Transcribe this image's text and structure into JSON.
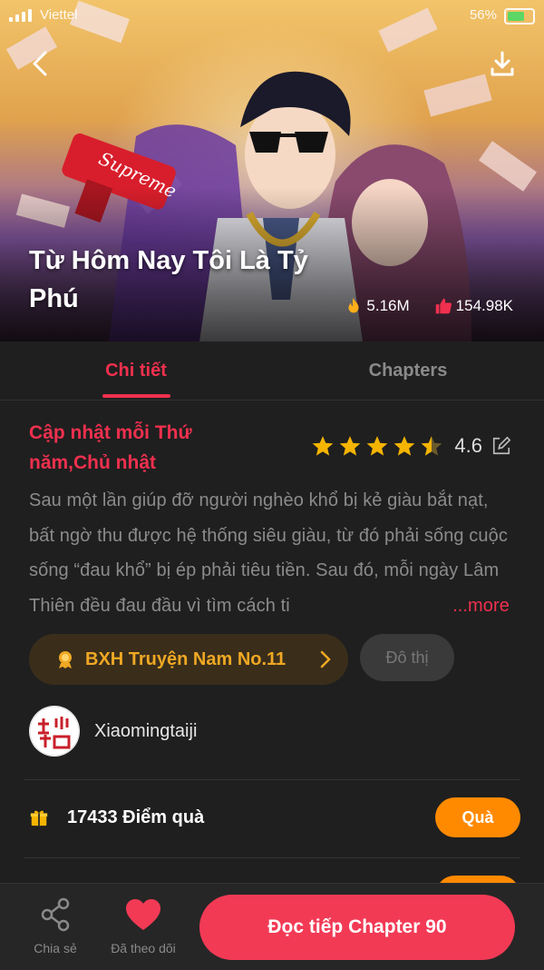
{
  "status_bar": {
    "carrier": "Viettel",
    "battery": "56%"
  },
  "hero": {
    "title": "Từ Hôm Nay Tôi Là Tỷ Phú",
    "views": "5.16M",
    "likes": "154.98K"
  },
  "tabs": [
    {
      "label": "Chi tiết",
      "active": true
    },
    {
      "label": "Chapters",
      "active": false
    }
  ],
  "details": {
    "schedule": "Cập nhật mỗi Thứ năm,Chủ nhật",
    "rating": "4.6",
    "rating_stars": 4.5,
    "description": "Sau một lần giúp đỡ người nghèo khổ bị kẻ giàu bắt nạt, bất ngờ thu được hệ thống siêu giàu, từ đó phải sống cuộc sống “đau khổ” bị ép phải tiêu tiền. Sau đó, mỗi ngày Lâm Thiên đều đau đầu vì tìm cách ti",
    "more": "...more",
    "rank": "BXH Truyện Nam No.11",
    "genre": "Đô thị"
  },
  "author": {
    "name": "Xiaomingtaiji"
  },
  "gift": {
    "points": "17433 Điểm quà",
    "button": "Quà"
  },
  "bottom_bar": {
    "share": "Chia sẻ",
    "follow": "Đã theo dõi",
    "read": "Đọc tiếp Chapter 90"
  },
  "colors": {
    "accent": "#f0304e",
    "orange": "#ff8a00",
    "gold": "#f0a824",
    "background": "#1f1f1f"
  }
}
